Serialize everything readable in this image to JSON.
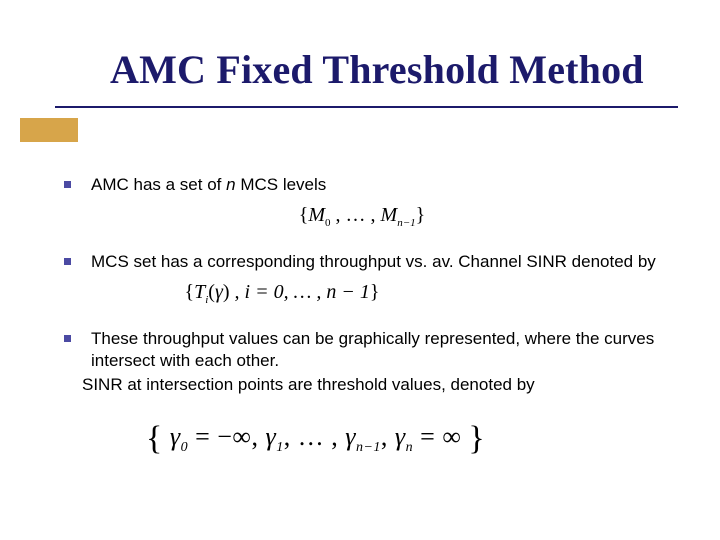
{
  "title": "AMC Fixed Threshold Method",
  "bullets": [
    {
      "pre": "AMC has a set of ",
      "ital": "n",
      "post": " MCS levels"
    },
    {
      "pre": "MCS set has a corresponding throughput vs. av. Channel SINR denoted by",
      "ital": "",
      "post": ""
    },
    {
      "pre": "These throughput values can be graphically represented, where the curves intersect with each other.",
      "ital": "",
      "post": ""
    }
  ],
  "subline": "SINR at intersection points are threshold values, denoted by",
  "formula1": {
    "open": "{",
    "m": "M",
    "sub0": "0",
    "mid": " , … , ",
    "m2": "M",
    "sub1": "n−1",
    "close": "}"
  },
  "formula2": {
    "open": "{",
    "t": "T",
    "sub_i": "i",
    "lp": "(",
    "gamma": "γ",
    "rp": ")",
    "mid": " , i = 0, … , n − 1",
    "close": "}"
  },
  "formula3": {
    "open": "{",
    "g": "γ",
    "sub0": "0",
    "eq1": " = −∞, ",
    "g1": "γ",
    "sub1": "1",
    "mid": ", … , ",
    "g2": "γ",
    "sub2": "n−1",
    "comma": ", ",
    "g3": "γ",
    "sub3": "n",
    "eq2": " = ∞",
    "close": "}"
  }
}
